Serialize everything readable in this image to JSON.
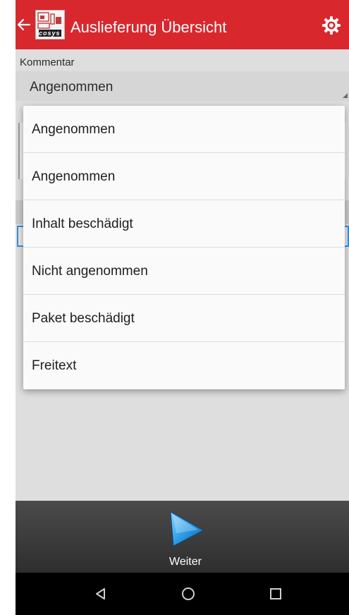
{
  "app_bar": {
    "title": "Auslieferung Übersicht",
    "logo_text": "cosys",
    "icons": {
      "back": "back-arrow-icon",
      "settings": "gear-icon"
    }
  },
  "form": {
    "comment_label": "Kommentar",
    "spinner_value": "Angenommen"
  },
  "dropdown": {
    "options": [
      "Angenommen",
      "Angenommen",
      "Inhalt beschädigt",
      "Nicht angenommen",
      "Paket beschädigt",
      "Freitext"
    ]
  },
  "bottom_bar": {
    "next_label": "Weiter",
    "next_icon": "play-arrow-icon"
  },
  "nav_bar": {
    "back_icon": "nav-back-icon",
    "home_icon": "nav-home-icon",
    "recents_icon": "nav-recents-icon"
  },
  "colors": {
    "app_bar": "#d9272e",
    "accent_blue": "#3a8fd8",
    "action_bar": "#3a3a3a"
  }
}
